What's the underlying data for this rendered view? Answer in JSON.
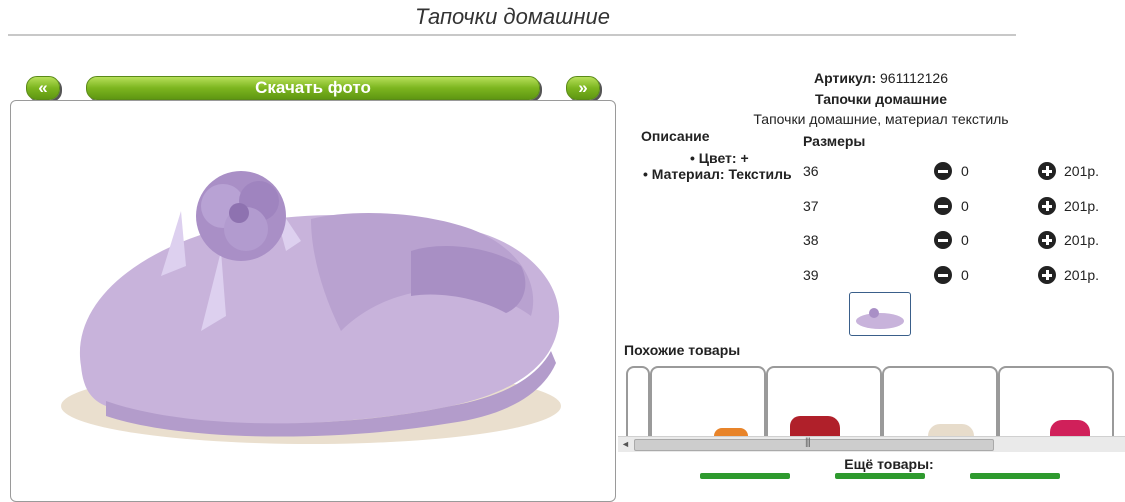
{
  "page": {
    "title": "Тапочки домашние"
  },
  "nav": {
    "prev_label": "«",
    "download_label": "Скачать фото",
    "next_label": "»"
  },
  "product": {
    "article_label": "Артикул:",
    "article_value": "961112126",
    "name": "Тапочки домашние",
    "short_desc": "Тапочки домашние, материал текстиль"
  },
  "description": {
    "heading": "Описание",
    "items": [
      {
        "text": "Цвет: +"
      },
      {
        "text": "Материал: Текстиль"
      }
    ]
  },
  "sizes": {
    "heading": "Размеры",
    "rows": [
      {
        "size": "36",
        "qty": "0",
        "price": "201р."
      },
      {
        "size": "37",
        "qty": "0",
        "price": "201р."
      },
      {
        "size": "38",
        "qty": "0",
        "price": "201р."
      },
      {
        "size": "39",
        "qty": "0",
        "price": "201р."
      }
    ]
  },
  "similar": {
    "heading": "Похожие товары",
    "scroll_left": "◄",
    "scroll_right": "►",
    "grip": "|||"
  },
  "more": {
    "heading": "Ещё товары:"
  },
  "colors": {
    "accent_green": "#7cb51f",
    "slipper": "#c9b3dc"
  }
}
